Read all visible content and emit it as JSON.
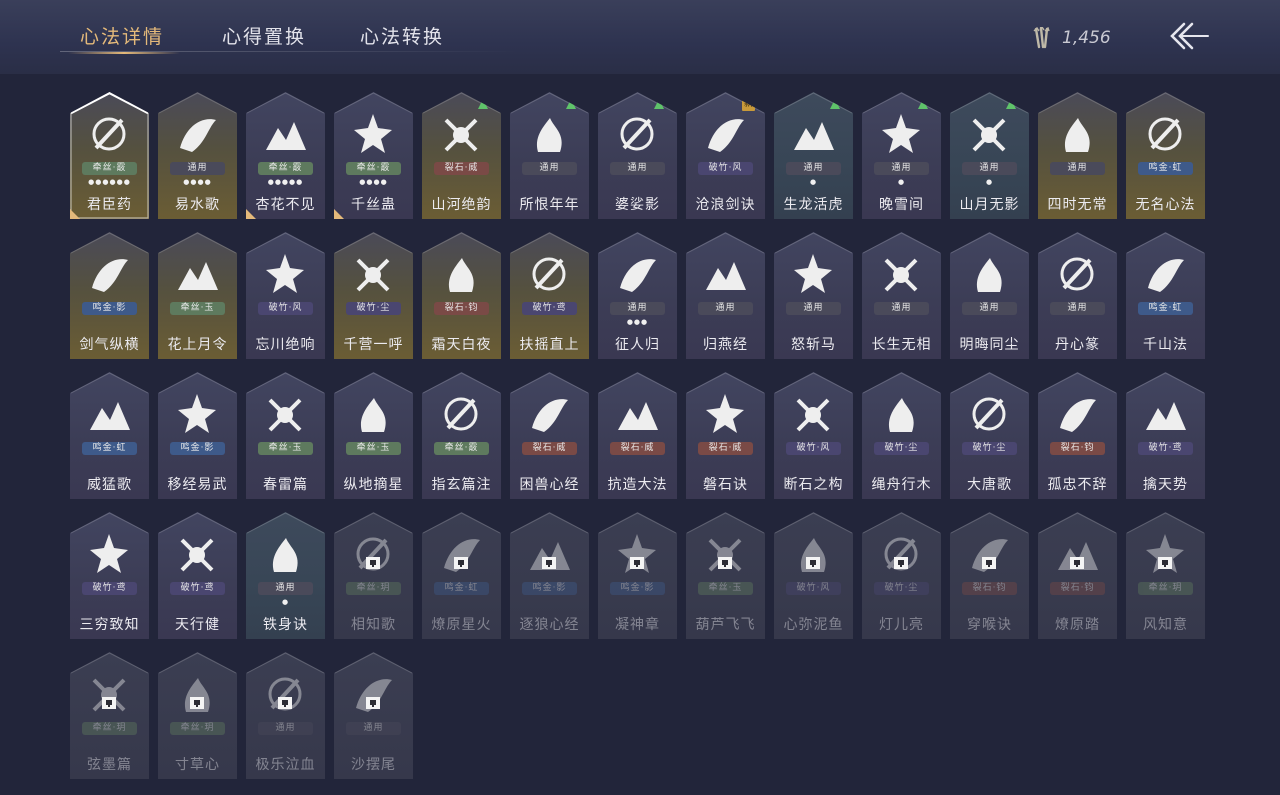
{
  "tabs": [
    {
      "label": "心法详情",
      "active": true
    },
    {
      "label": "心得置换",
      "active": false
    },
    {
      "label": "心法转换",
      "active": false
    }
  ],
  "currency": {
    "icon": "arrows-currency-icon",
    "amount": "1,456"
  },
  "back_button": {
    "icon": "back-arrow-icon"
  },
  "colors": {
    "gold": "#e4b97a",
    "badge_cansi": "#5e7a5e",
    "badge_lieshi": "#7a4a46",
    "badge_pozhu": "#4a4670",
    "badge_mingjin": "#3e5a8a",
    "badge_tongyong": "#4a4a5a",
    "new_tag": "#c99a3a",
    "upgrade_arrow": "#5fc36a"
  },
  "cards": [
    {
      "name": "君臣药",
      "badge": "牵丝·霰",
      "dots": "●●●●●●",
      "tone": "gold",
      "corner": true,
      "selected": true,
      "icon": "mortar-bowl-icon"
    },
    {
      "name": "易水歌",
      "badge": "通用",
      "dots": "●●●●",
      "tone": "gold",
      "icon": "horse-icon"
    },
    {
      "name": "杏花不见",
      "badge": "牵丝·霰",
      "dots": "●●●●●",
      "tone": "purple",
      "corner": true,
      "icon": "flower-icon"
    },
    {
      "name": "千丝蛊",
      "badge": "牵丝·霰",
      "dots": "●●●●",
      "tone": "purple",
      "corner": true,
      "icon": "leaf-icon"
    },
    {
      "name": "山河绝韵",
      "badge": "裂石·威",
      "tone": "gold",
      "up": true,
      "icon": "mountain-icon"
    },
    {
      "name": "所恨年年",
      "badge": "通用",
      "tone": "purple",
      "up": true,
      "icon": "bamboo-icon"
    },
    {
      "name": "婆娑影",
      "badge": "通用",
      "tone": "purple",
      "up": true,
      "icon": "dragon-icon"
    },
    {
      "name": "沧浪剑诀",
      "badge": "破竹·风",
      "tone": "purple",
      "new": "新",
      "icon": "dragon-sword-icon"
    },
    {
      "name": "生龙活虎",
      "badge": "通用",
      "dots": "●",
      "tone": "blue",
      "up": true,
      "icon": "swirl-icon"
    },
    {
      "name": "晚雪间",
      "badge": "通用",
      "dots": "●",
      "tone": "purple",
      "up": true,
      "icon": "cross-spiral-icon"
    },
    {
      "name": "山月无影",
      "badge": "通用",
      "dots": "●",
      "tone": "blue",
      "up": true,
      "icon": "moon-blade-icon"
    },
    {
      "name": "四时无常",
      "badge": "通用",
      "tone": "gold",
      "icon": "cloud-icon"
    },
    {
      "name": "无名心法",
      "badge": "鸣金·虹",
      "tone": "gold",
      "icon": "staff-icon"
    },
    {
      "name": "剑气纵横",
      "badge": "鸣金·影",
      "tone": "gold",
      "icon": "crossed-swords-icon"
    },
    {
      "name": "花上月令",
      "badge": "牵丝·玉",
      "tone": "gold",
      "icon": "rose-icon"
    },
    {
      "name": "忘川绝响",
      "badge": "破竹·风",
      "tone": "purple",
      "icon": "mask-icon"
    },
    {
      "name": "千营一呼",
      "badge": "破竹·尘",
      "tone": "gold",
      "icon": "flag-icon"
    },
    {
      "name": "霜天白夜",
      "badge": "裂石·钧",
      "tone": "gold",
      "icon": "sword-ground-icon"
    },
    {
      "name": "扶摇直上",
      "badge": "破竹·鸢",
      "tone": "gold",
      "icon": "eagle-icon"
    },
    {
      "name": "征人归",
      "badge": "通用",
      "dots": "●●●",
      "tone": "purple",
      "icon": "hand-bird-icon"
    },
    {
      "name": "归燕经",
      "badge": "通用",
      "tone": "purple",
      "icon": "swallow-icon"
    },
    {
      "name": "怒斩马",
      "badge": "通用",
      "tone": "purple",
      "icon": "blade-icon"
    },
    {
      "name": "长生无相",
      "badge": "通用",
      "tone": "purple",
      "icon": "buddha-icon"
    },
    {
      "name": "明晦同尘",
      "badge": "通用",
      "tone": "purple",
      "icon": "knot-icon"
    },
    {
      "name": "丹心篆",
      "badge": "通用",
      "tone": "purple",
      "icon": "wave-sword-icon"
    },
    {
      "name": "千山法",
      "badge": "鸣金·虹",
      "tone": "purple",
      "icon": "peaks-icon"
    },
    {
      "name": "威猛歌",
      "badge": "鸣金·虹",
      "tone": "purple",
      "icon": "palms-icon"
    },
    {
      "name": "移经易武",
      "badge": "鸣金·影",
      "tone": "purple",
      "icon": "monk-icon"
    },
    {
      "name": "春雷篇",
      "badge": "牵丝·玉",
      "tone": "purple",
      "icon": "storm-tree-icon"
    },
    {
      "name": "纵地摘星",
      "badge": "牵丝·玉",
      "tone": "purple",
      "icon": "star-hand-icon"
    },
    {
      "name": "指玄篇注",
      "badge": "牵丝·霰",
      "tone": "purple",
      "icon": "yin-yang-icon"
    },
    {
      "name": "困兽心经",
      "badge": "裂石·威",
      "tone": "purple",
      "icon": "chain-icon"
    },
    {
      "name": "抗造大法",
      "badge": "裂石·威",
      "tone": "purple",
      "icon": "bell-icon"
    },
    {
      "name": "磐石诀",
      "badge": "裂石·威",
      "tone": "purple",
      "icon": "rock-icon"
    },
    {
      "name": "断石之构",
      "badge": "破竹·风",
      "tone": "purple",
      "icon": "warrior-icon"
    },
    {
      "name": "绳舟行木",
      "badge": "破竹·尘",
      "tone": "purple",
      "icon": "roots-icon"
    },
    {
      "name": "大唐歌",
      "badge": "破竹·尘",
      "tone": "purple",
      "icon": "palace-icon"
    },
    {
      "name": "孤忠不辞",
      "badge": "裂石·钧",
      "tone": "purple",
      "icon": "crossed-spears-icon"
    },
    {
      "name": "擒天势",
      "badge": "破竹·鸢",
      "tone": "purple",
      "icon": "chained-fist-icon"
    },
    {
      "name": "三穷致知",
      "badge": "破竹·鸢",
      "tone": "purple",
      "icon": "scroll-icon"
    },
    {
      "name": "天行健",
      "badge": "破竹·鸢",
      "tone": "purple",
      "icon": "umbrella-icon"
    },
    {
      "name": "铁身诀",
      "badge": "通用",
      "dots": "●",
      "tone": "blue",
      "icon": "muscle-icon"
    },
    {
      "name": "相知歌",
      "badge": "牵丝·玥",
      "tone": "purple",
      "locked": true,
      "icon": "dancer-icon"
    },
    {
      "name": "燎原星火",
      "badge": "鸣金·虹",
      "tone": "purple",
      "locked": true,
      "icon": "spear-icon"
    },
    {
      "name": "逐狼心经",
      "badge": "鸣金·影",
      "tone": "purple",
      "locked": true,
      "icon": "wolf-icon"
    },
    {
      "name": "凝神章",
      "badge": "鸣金·影",
      "tone": "purple",
      "locked": true,
      "icon": "bow-icon"
    },
    {
      "name": "葫芦飞飞",
      "badge": "牵丝·玉",
      "tone": "purple",
      "locked": true,
      "icon": "gourd-icon"
    },
    {
      "name": "心弥泥鱼",
      "badge": "破竹·风",
      "tone": "purple",
      "locked": true,
      "icon": "fish-icon"
    },
    {
      "name": "灯儿亮",
      "badge": "破竹·尘",
      "tone": "purple",
      "locked": true,
      "icon": "lantern-icon"
    },
    {
      "name": "穿喉诀",
      "badge": "裂石·钧",
      "tone": "purple",
      "locked": true,
      "icon": "skull-icon"
    },
    {
      "name": "燎原踏",
      "badge": "裂石·钧",
      "tone": "purple",
      "locked": true,
      "icon": "running-horse-icon"
    },
    {
      "name": "风知意",
      "badge": "牵丝·玥",
      "tone": "purple",
      "locked": true,
      "icon": "fan-icon"
    },
    {
      "name": "弦墨篇",
      "badge": "牵丝·玥",
      "tone": "purple",
      "locked": true,
      "icon": "brush-icon"
    },
    {
      "name": "寸草心",
      "badge": "牵丝·玥",
      "tone": "purple",
      "locked": true,
      "icon": "sprout-icon"
    },
    {
      "name": "极乐泣血",
      "badge": "通用",
      "tone": "purple",
      "locked": true,
      "icon": "wings-icon"
    },
    {
      "name": "沙摆尾",
      "badge": "通用",
      "tone": "purple",
      "locked": true,
      "icon": "tail-icon"
    }
  ]
}
